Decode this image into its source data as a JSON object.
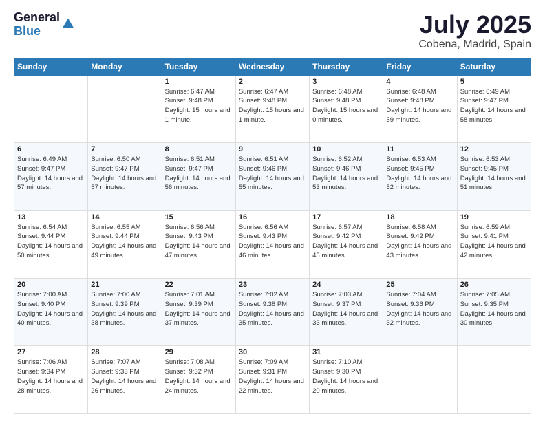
{
  "logo": {
    "general": "General",
    "blue": "Blue"
  },
  "header": {
    "month": "July 2025",
    "location": "Cobena, Madrid, Spain"
  },
  "days_of_week": [
    "Sunday",
    "Monday",
    "Tuesday",
    "Wednesday",
    "Thursday",
    "Friday",
    "Saturday"
  ],
  "weeks": [
    [
      {
        "day": "",
        "sunrise": "",
        "sunset": "",
        "daylight": ""
      },
      {
        "day": "",
        "sunrise": "",
        "sunset": "",
        "daylight": ""
      },
      {
        "day": "1",
        "sunrise": "Sunrise: 6:47 AM",
        "sunset": "Sunset: 9:48 PM",
        "daylight": "Daylight: 15 hours and 1 minute."
      },
      {
        "day": "2",
        "sunrise": "Sunrise: 6:47 AM",
        "sunset": "Sunset: 9:48 PM",
        "daylight": "Daylight: 15 hours and 1 minute."
      },
      {
        "day": "3",
        "sunrise": "Sunrise: 6:48 AM",
        "sunset": "Sunset: 9:48 PM",
        "daylight": "Daylight: 15 hours and 0 minutes."
      },
      {
        "day": "4",
        "sunrise": "Sunrise: 6:48 AM",
        "sunset": "Sunset: 9:48 PM",
        "daylight": "Daylight: 14 hours and 59 minutes."
      },
      {
        "day": "5",
        "sunrise": "Sunrise: 6:49 AM",
        "sunset": "Sunset: 9:47 PM",
        "daylight": "Daylight: 14 hours and 58 minutes."
      }
    ],
    [
      {
        "day": "6",
        "sunrise": "Sunrise: 6:49 AM",
        "sunset": "Sunset: 9:47 PM",
        "daylight": "Daylight: 14 hours and 57 minutes."
      },
      {
        "day": "7",
        "sunrise": "Sunrise: 6:50 AM",
        "sunset": "Sunset: 9:47 PM",
        "daylight": "Daylight: 14 hours and 57 minutes."
      },
      {
        "day": "8",
        "sunrise": "Sunrise: 6:51 AM",
        "sunset": "Sunset: 9:47 PM",
        "daylight": "Daylight: 14 hours and 56 minutes."
      },
      {
        "day": "9",
        "sunrise": "Sunrise: 6:51 AM",
        "sunset": "Sunset: 9:46 PM",
        "daylight": "Daylight: 14 hours and 55 minutes."
      },
      {
        "day": "10",
        "sunrise": "Sunrise: 6:52 AM",
        "sunset": "Sunset: 9:46 PM",
        "daylight": "Daylight: 14 hours and 53 minutes."
      },
      {
        "day": "11",
        "sunrise": "Sunrise: 6:53 AM",
        "sunset": "Sunset: 9:45 PM",
        "daylight": "Daylight: 14 hours and 52 minutes."
      },
      {
        "day": "12",
        "sunrise": "Sunrise: 6:53 AM",
        "sunset": "Sunset: 9:45 PM",
        "daylight": "Daylight: 14 hours and 51 minutes."
      }
    ],
    [
      {
        "day": "13",
        "sunrise": "Sunrise: 6:54 AM",
        "sunset": "Sunset: 9:44 PM",
        "daylight": "Daylight: 14 hours and 50 minutes."
      },
      {
        "day": "14",
        "sunrise": "Sunrise: 6:55 AM",
        "sunset": "Sunset: 9:44 PM",
        "daylight": "Daylight: 14 hours and 49 minutes."
      },
      {
        "day": "15",
        "sunrise": "Sunrise: 6:56 AM",
        "sunset": "Sunset: 9:43 PM",
        "daylight": "Daylight: 14 hours and 47 minutes."
      },
      {
        "day": "16",
        "sunrise": "Sunrise: 6:56 AM",
        "sunset": "Sunset: 9:43 PM",
        "daylight": "Daylight: 14 hours and 46 minutes."
      },
      {
        "day": "17",
        "sunrise": "Sunrise: 6:57 AM",
        "sunset": "Sunset: 9:42 PM",
        "daylight": "Daylight: 14 hours and 45 minutes."
      },
      {
        "day": "18",
        "sunrise": "Sunrise: 6:58 AM",
        "sunset": "Sunset: 9:42 PM",
        "daylight": "Daylight: 14 hours and 43 minutes."
      },
      {
        "day": "19",
        "sunrise": "Sunrise: 6:59 AM",
        "sunset": "Sunset: 9:41 PM",
        "daylight": "Daylight: 14 hours and 42 minutes."
      }
    ],
    [
      {
        "day": "20",
        "sunrise": "Sunrise: 7:00 AM",
        "sunset": "Sunset: 9:40 PM",
        "daylight": "Daylight: 14 hours and 40 minutes."
      },
      {
        "day": "21",
        "sunrise": "Sunrise: 7:00 AM",
        "sunset": "Sunset: 9:39 PM",
        "daylight": "Daylight: 14 hours and 38 minutes."
      },
      {
        "day": "22",
        "sunrise": "Sunrise: 7:01 AM",
        "sunset": "Sunset: 9:39 PM",
        "daylight": "Daylight: 14 hours and 37 minutes."
      },
      {
        "day": "23",
        "sunrise": "Sunrise: 7:02 AM",
        "sunset": "Sunset: 9:38 PM",
        "daylight": "Daylight: 14 hours and 35 minutes."
      },
      {
        "day": "24",
        "sunrise": "Sunrise: 7:03 AM",
        "sunset": "Sunset: 9:37 PM",
        "daylight": "Daylight: 14 hours and 33 minutes."
      },
      {
        "day": "25",
        "sunrise": "Sunrise: 7:04 AM",
        "sunset": "Sunset: 9:36 PM",
        "daylight": "Daylight: 14 hours and 32 minutes."
      },
      {
        "day": "26",
        "sunrise": "Sunrise: 7:05 AM",
        "sunset": "Sunset: 9:35 PM",
        "daylight": "Daylight: 14 hours and 30 minutes."
      }
    ],
    [
      {
        "day": "27",
        "sunrise": "Sunrise: 7:06 AM",
        "sunset": "Sunset: 9:34 PM",
        "daylight": "Daylight: 14 hours and 28 minutes."
      },
      {
        "day": "28",
        "sunrise": "Sunrise: 7:07 AM",
        "sunset": "Sunset: 9:33 PM",
        "daylight": "Daylight: 14 hours and 26 minutes."
      },
      {
        "day": "29",
        "sunrise": "Sunrise: 7:08 AM",
        "sunset": "Sunset: 9:32 PM",
        "daylight": "Daylight: 14 hours and 24 minutes."
      },
      {
        "day": "30",
        "sunrise": "Sunrise: 7:09 AM",
        "sunset": "Sunset: 9:31 PM",
        "daylight": "Daylight: 14 hours and 22 minutes."
      },
      {
        "day": "31",
        "sunrise": "Sunrise: 7:10 AM",
        "sunset": "Sunset: 9:30 PM",
        "daylight": "Daylight: 14 hours and 20 minutes."
      },
      {
        "day": "",
        "sunrise": "",
        "sunset": "",
        "daylight": ""
      },
      {
        "day": "",
        "sunrise": "",
        "sunset": "",
        "daylight": ""
      }
    ]
  ]
}
